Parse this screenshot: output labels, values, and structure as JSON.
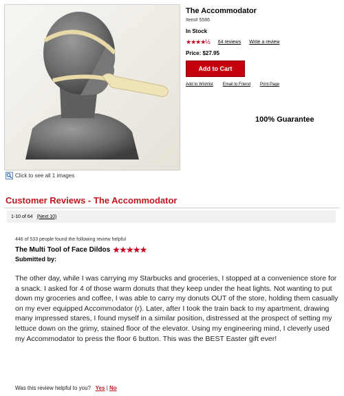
{
  "product": {
    "title": "The Accommodator",
    "item_number": "Item# 5586",
    "stock_status": "In Stock",
    "rating_stars": "★★★★½",
    "reviews_link": "64 reviews",
    "write_review_link": "Write a review",
    "price": "Price: $27.95",
    "add_to_cart": "Add to Cart",
    "links": {
      "wishlist": "Add to Wishlist",
      "email": "Email to Friend",
      "print": "Print Page"
    },
    "guarantee": "100% Guarantee",
    "see_images": "Click to see all 1 images"
  },
  "reviews": {
    "heading": "Customer Reviews - The Accommodator",
    "range": "1-10 of 64",
    "next_link": "(Next 10)",
    "items": [
      {
        "helpful_count": "446 of 533 people found the following review helpful",
        "title": "The Multi Tool of Face Dildos",
        "stars": "★★★★★",
        "submitted_by": "Submitted by:",
        "body": "The other day, while I was carrying my Starbucks and groceries, I stopped at a convenience store for a snack. I asked for 4 of those warm donuts that they keep under the heat lights. Not wanting to put down my groceries and coffee, I was able to carry my donuts OUT of the store, holding them casually on my ever equipped Accommodator (r). Later, after I took the train back to my apartment, drawing many impressed stares, I found myself in a similar position, distressed at the prospect of setting my lettuce down on the grimy, stained floor of the elevator. Using my engineering mind, I cleverly used my Accommodator to press the floor 6 button. This was the BEST Easter gift ever!",
        "helpful_question": "Was this review helpful to you?",
        "yes": "Yes",
        "separator": "|",
        "no": "No"
      }
    ]
  },
  "colors": {
    "accent_red": "#c0161f",
    "button_red": "#c4000e",
    "bust_gray": "#6e6e6e",
    "strap_tan": "#e8d9a8"
  },
  "icons": {
    "zoom": "magnify-icon"
  }
}
